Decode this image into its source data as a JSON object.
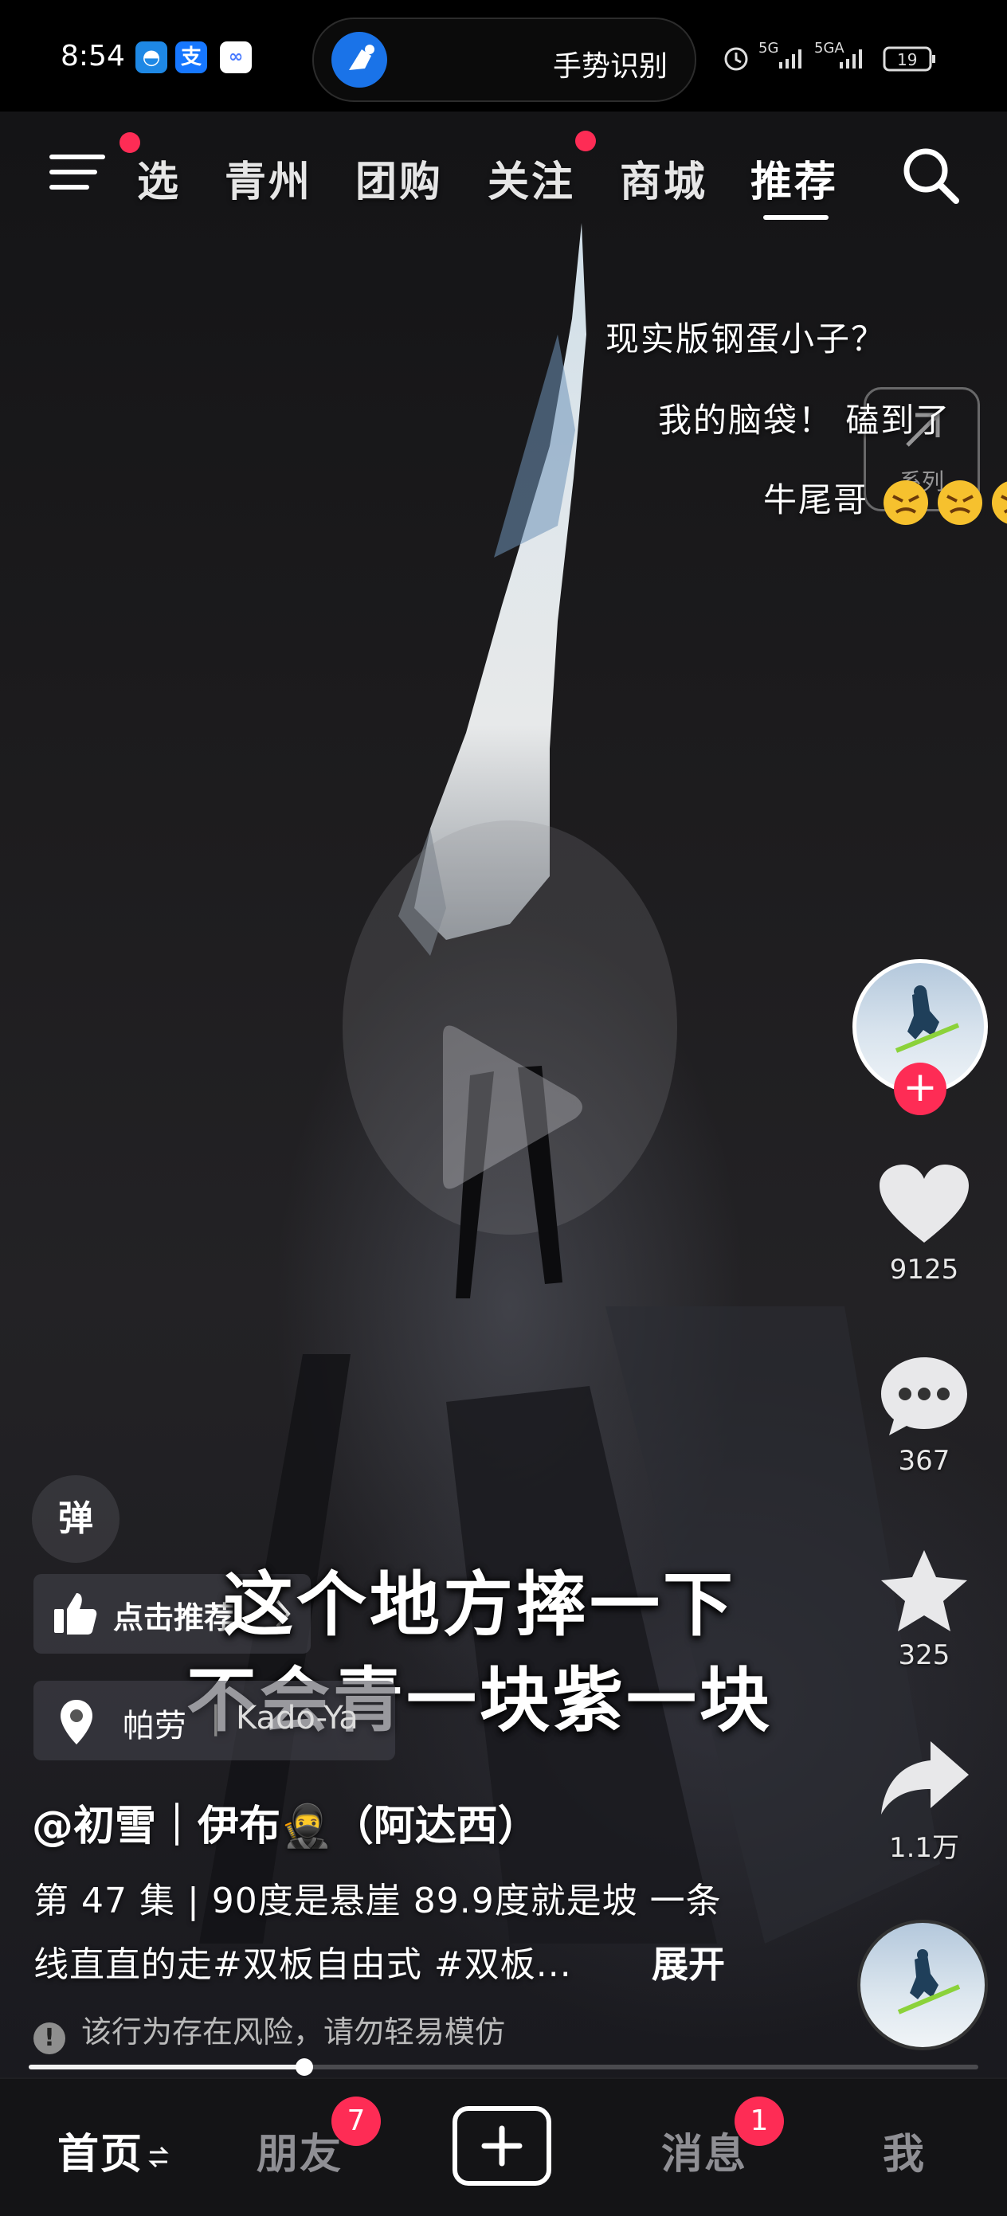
{
  "status_bar": {
    "time": "8:54",
    "island_text": "手势识别",
    "signal_1": "5G",
    "signal_2": "5GA",
    "battery": "19"
  },
  "top_nav": {
    "tabs": [
      {
        "label": "选",
        "dot": true
      },
      {
        "label": "青州",
        "dot": false
      },
      {
        "label": "团购",
        "dot": false
      },
      {
        "label": "关注",
        "dot": true
      },
      {
        "label": "商城",
        "dot": false
      },
      {
        "label": "推荐",
        "dot": false,
        "active": true
      }
    ]
  },
  "danmaku": [
    "现实版钢蛋小子？",
    "我的脑袋！ 磕到了",
    "牛尾哥"
  ],
  "share_hint": "系列",
  "side_actions": {
    "likes": "9125",
    "comments": "367",
    "favorites": "325",
    "shares": "1.1万"
  },
  "danmu_toggle": "弹",
  "recommend_pill": "点击推荐",
  "location": {
    "name": "帕劳",
    "sub": "Kado-Ya"
  },
  "subtitle": {
    "line1": "这个地方摔一下",
    "line2": "不会青一块紫一块"
  },
  "author": "@初雪｜伊布🥷（阿达西）",
  "description": {
    "line1": "第 47 集 | 90度是悬崖 89.9度就是坡 一条",
    "line2": "线直直的走#双板自由式 #双板...",
    "expand": "展开"
  },
  "risk_notice": "该行为存在风险，请勿轻易模仿",
  "progress": 0.29,
  "bottom_nav": {
    "home": "首页",
    "friends": "朋友",
    "friends_badge": "7",
    "messages": "消息",
    "messages_badge": "1",
    "me": "我"
  },
  "colors": {
    "accent": "#fe2c55",
    "background": "#0a0a0c"
  }
}
